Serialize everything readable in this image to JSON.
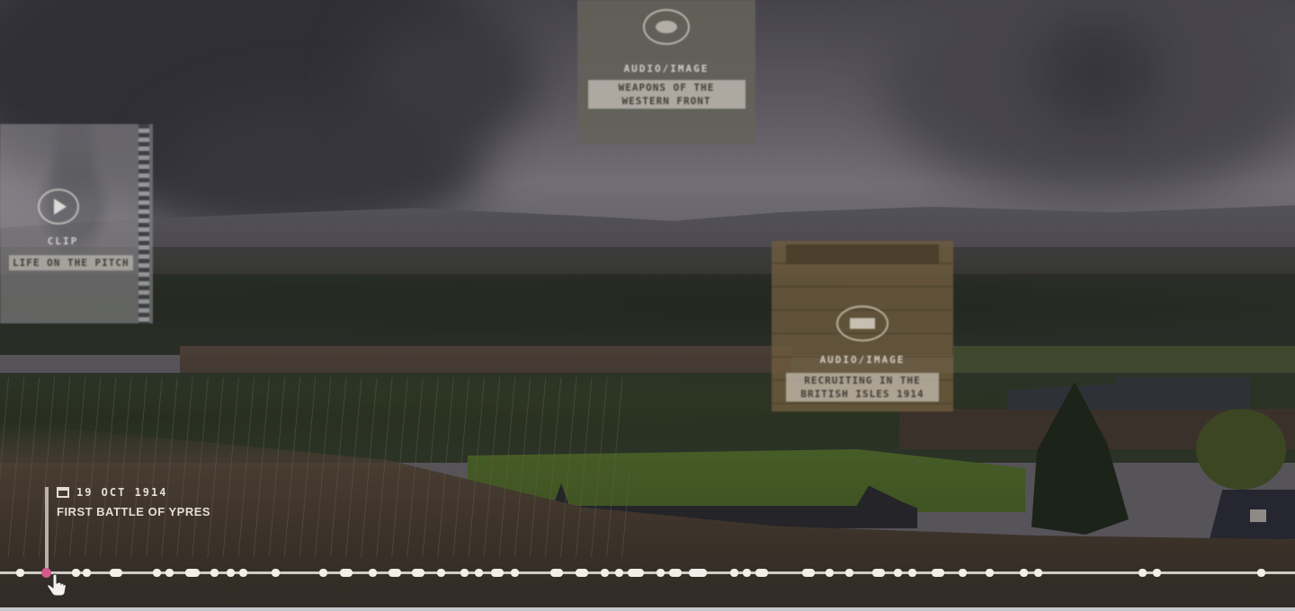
{
  "cards": {
    "top": {
      "type": "Audio/Image",
      "title": "Weapons of the Western Front",
      "blurred": true
    },
    "left": {
      "type": "Clip",
      "title": "Life on the pitch",
      "blurred": true
    },
    "middle": {
      "type": "Audio/Image",
      "title": "Recruiting in the British Isles 1914",
      "blurred": true
    }
  },
  "timeline": {
    "selected_event": {
      "date": "19 Oct 1914",
      "title": "First Battle of Ypres"
    },
    "events_count": 46,
    "marker_color": "#d45a8c"
  },
  "icons": {
    "calendar": "calendar-icon",
    "cursor": "hand-pointer-icon",
    "play": "play-icon"
  }
}
